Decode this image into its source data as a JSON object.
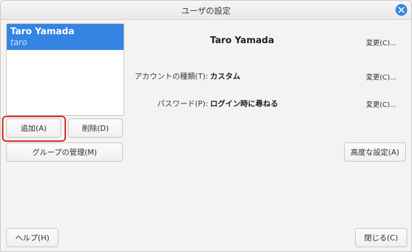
{
  "window": {
    "title": "ユーザの設定"
  },
  "user_list": [
    {
      "name": "Taro Yamada",
      "login": "taro"
    }
  ],
  "buttons": {
    "add": "追加(A)",
    "delete": "削除(D)",
    "manage_groups": "グループの管理(M)",
    "advanced": "高度な設定(A)",
    "help": "ヘルプ(H)",
    "close": "閉じる(C)"
  },
  "details": {
    "full_name": "Taro Yamada",
    "account_type_label": "アカウントの種類(T):",
    "account_type_value": "カスタム",
    "password_label": "パスワード(P):",
    "password_value": "ログイン時に尋ねる",
    "change_label": "変更(C)..."
  },
  "colors": {
    "accent": "#3584e4",
    "highlight": "#d9281f"
  }
}
